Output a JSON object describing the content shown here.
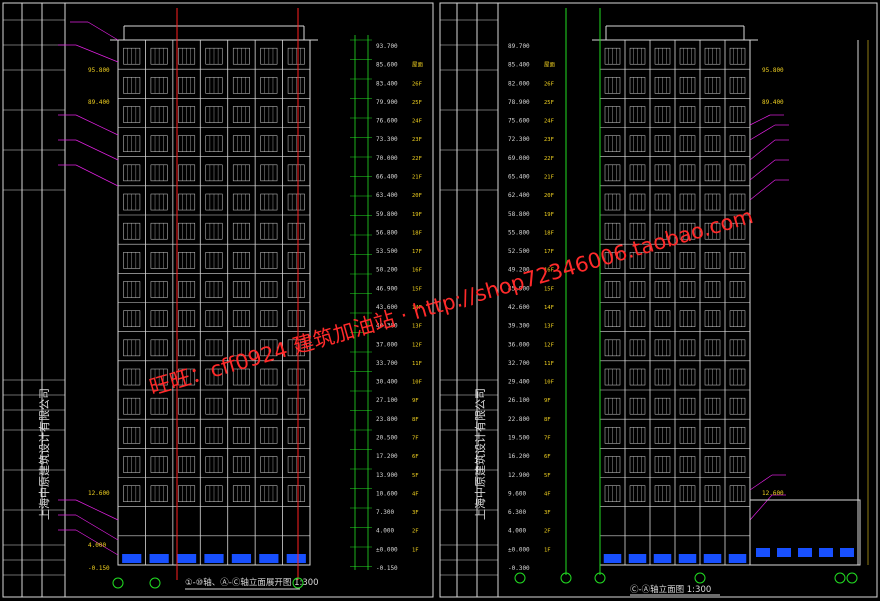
{
  "drawing": {
    "left_sheet": {
      "title": "①-⑩轴、Ⓐ-Ⓒ轴立面展开图 1:300",
      "firm": "上海中原建筑设计有限公司",
      "level_labels": [
        "93.700",
        "85.600",
        "83.400",
        "79.900",
        "76.600",
        "73.300",
        "70.000",
        "66.400",
        "63.400",
        "59.800",
        "56.800",
        "53.500",
        "50.200",
        "46.900",
        "43.600",
        "40.300",
        "37.000",
        "33.700",
        "30.400",
        "27.100",
        "23.800",
        "20.500",
        "17.200",
        "13.900",
        "10.600",
        "7.300",
        "4.000",
        "±0.000",
        "-0.150"
      ],
      "floor_labels": [
        "屋面",
        "26F",
        "25F",
        "24F",
        "23F",
        "22F",
        "21F",
        "20F",
        "19F",
        "18F",
        "17F",
        "16F",
        "15F",
        "14F",
        "13F",
        "12F",
        "11F",
        "10F",
        "9F",
        "8F",
        "7F",
        "6F",
        "5F",
        "4F",
        "3F",
        "2F",
        "1F"
      ],
      "side_marks": [
        "95.800",
        "89.400",
        "12.600",
        "4.000",
        "-0.150"
      ]
    },
    "right_sheet": {
      "title": "Ⓒ-Ⓐ轴立面图 1:300",
      "firm": "上海中原建筑设计有限公司",
      "level_labels": [
        "89.700",
        "85.400",
        "82.000",
        "78.900",
        "75.600",
        "72.300",
        "69.000",
        "65.400",
        "62.400",
        "58.800",
        "55.800",
        "52.500",
        "49.200",
        "45.900",
        "42.600",
        "39.300",
        "36.000",
        "32.700",
        "29.400",
        "26.100",
        "22.800",
        "19.500",
        "16.200",
        "12.900",
        "9.600",
        "6.300",
        "4.000",
        "±0.000",
        "-0.300"
      ],
      "floor_labels": [
        "屋面",
        "26F",
        "25F",
        "24F",
        "23F",
        "22F",
        "21F",
        "20F",
        "19F",
        "18F",
        "17F",
        "16F",
        "15F",
        "14F",
        "13F",
        "12F",
        "11F",
        "10F",
        "9F",
        "8F",
        "7F",
        "6F",
        "5F",
        "4F",
        "3F",
        "2F",
        "1F"
      ],
      "side_marks": [
        "95.800",
        "89.400",
        "12.600"
      ]
    },
    "watermark_red": "旺旺：cff0924 建筑加油站 · http://shop72346006.taobao.com",
    "colors": {
      "background": "#000000",
      "linework": "#d8d8d8",
      "dim_green": "#22dd22",
      "level_yellow": "#f0d020",
      "leader_magenta": "#e020e0",
      "grid_red": "#ff2020",
      "glass_blue": "#1850ff",
      "watermark_red": "#ff2a2a"
    }
  }
}
